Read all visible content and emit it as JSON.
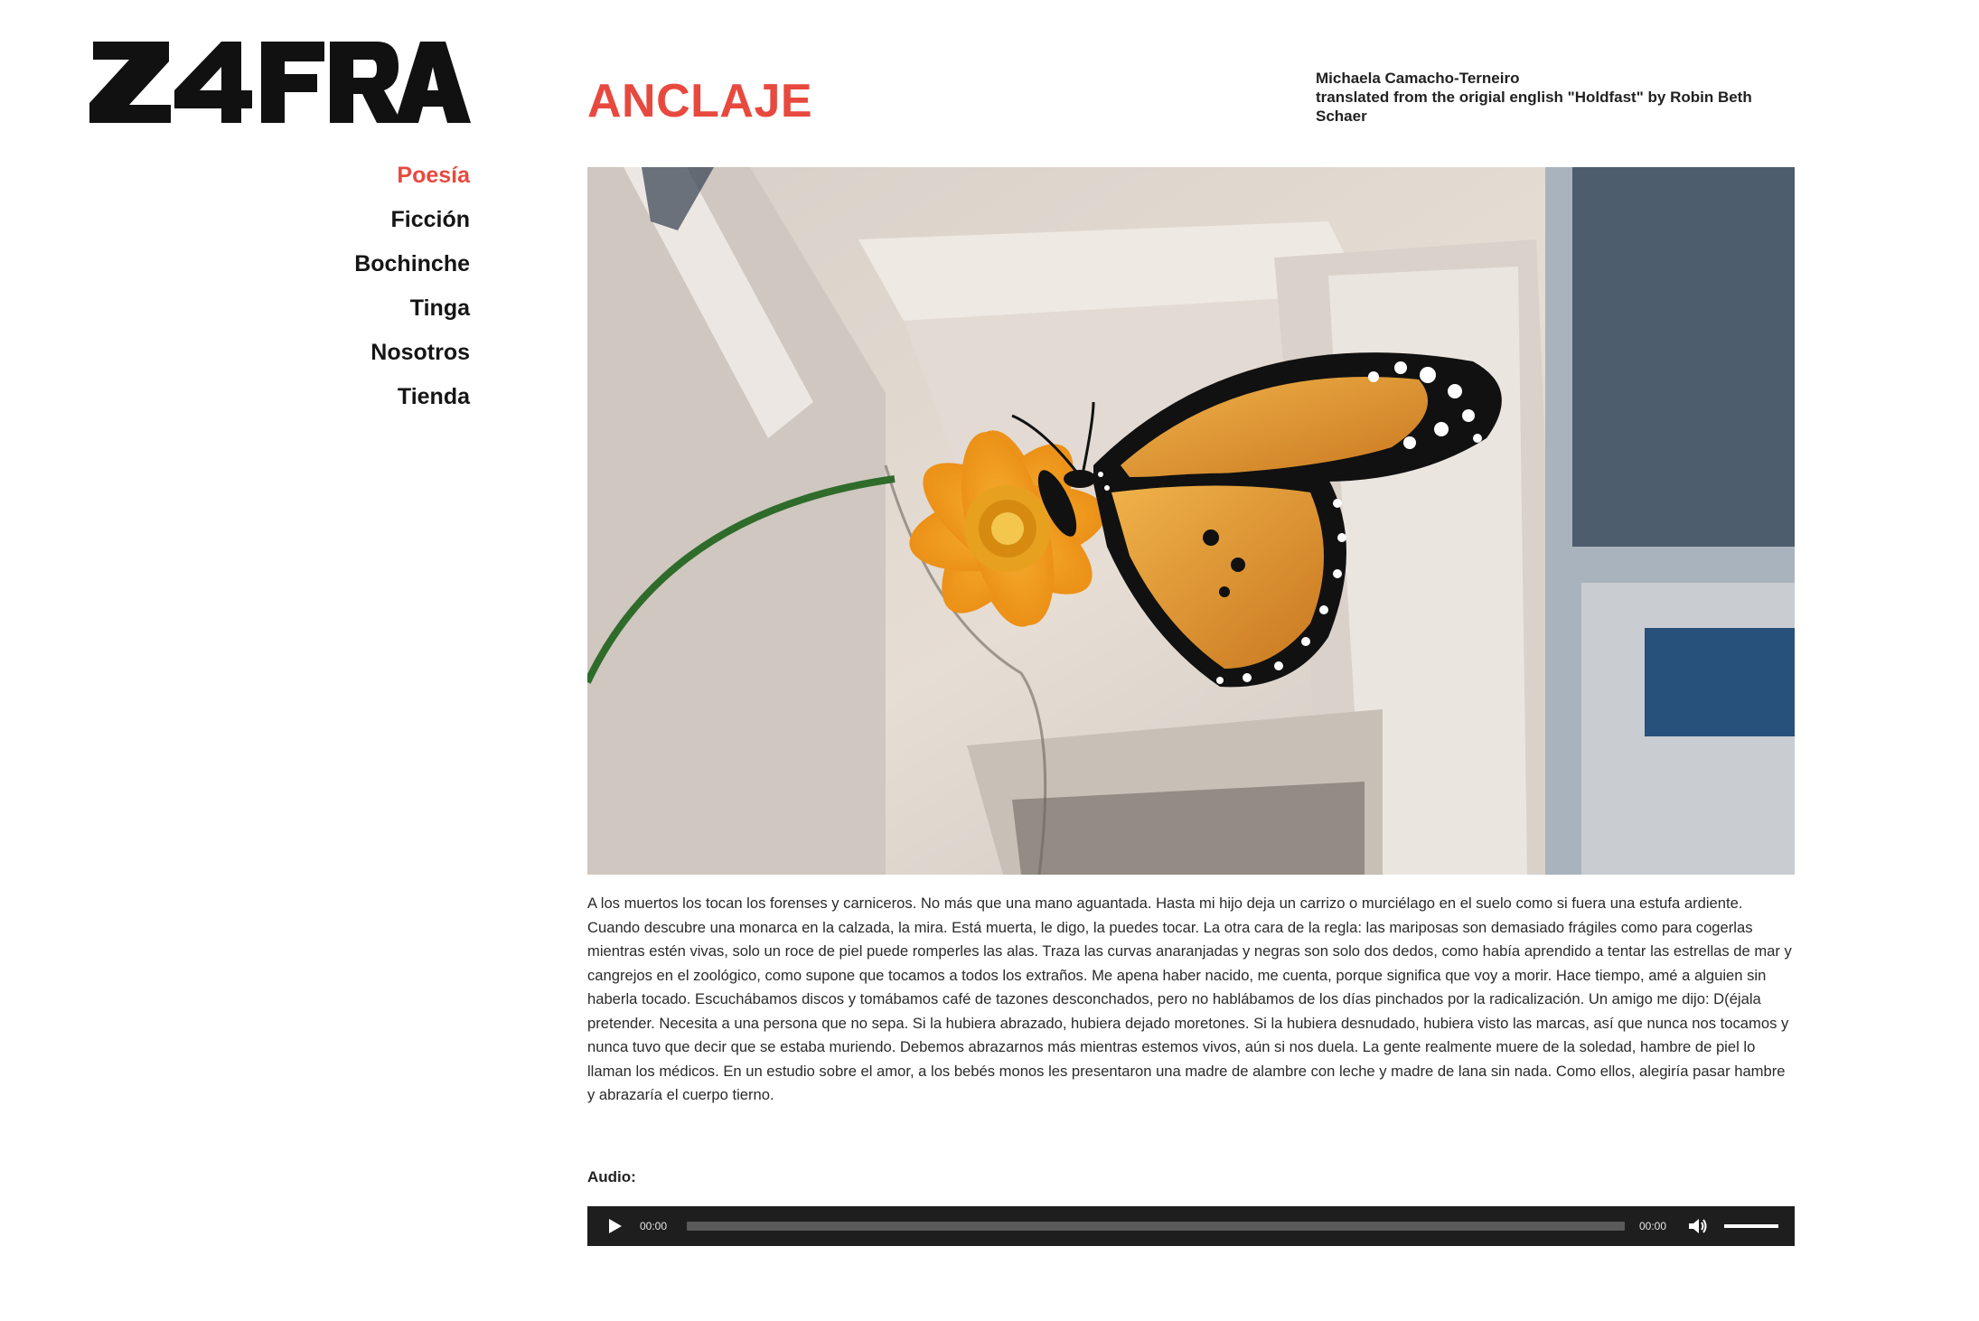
{
  "site": {
    "logo_text": "ZAFRA"
  },
  "nav": {
    "items": [
      {
        "label": "Poesía",
        "active": true
      },
      {
        "label": "Ficción",
        "active": false
      },
      {
        "label": "Bochinche",
        "active": false
      },
      {
        "label": "Tinga",
        "active": false
      },
      {
        "label": "Nosotros",
        "active": false
      },
      {
        "label": "Tienda",
        "active": false
      }
    ]
  },
  "article": {
    "title": "ANCLAJE",
    "author": "Michaela Camacho-Terneiro",
    "translation_note": "translated from the origial english \"Holdfast\" by Robin Beth Schaer",
    "hero_image": "butterfly-on-orange-flower",
    "body": "A los muertos los tocan los forenses y carniceros. No más que una mano aguantada. Hasta mi hijo deja un carrizo o murciélago en el suelo como si fuera una estufa ardiente. Cuando descubre una monarca en la calzada, la mira. Está muerta, le digo, la puedes tocar. La otra cara de la regla: las mariposas son demasiado frágiles como para cogerlas mientras estén vivas, solo un roce de piel puede romperles las alas. Traza las curvas anaranjadas y negras son solo dos dedos, como había aprendido a tentar las estrellas de mar y cangrejos en el zoológico, como supone que tocamos a todos los extraños. Me apena haber nacido, me cuenta, porque significa que voy a morir. Hace tiempo, amé a alguien sin haberla tocado. Escuchábamos discos y tomábamos café de tazones desconchados, pero no hablábamos de los días pinchados por la radicalización. Un amigo me dijo: D(éjala pretender. Necesita a una persona que no sepa. Si la hubiera abrazado, hubiera dejado moretones. Si la hubiera desnudado, hubiera visto las marcas, así que nunca nos tocamos y nunca tuvo que decir que se estaba muriendo. Debemos abrazarnos más mientras estemos vivos, aún si nos duela. La gente realmente muere de la soledad, hambre de piel lo llaman los médicos. En un estudio sobre el amor, a los bebés monos les presentaron una madre de alambre con leche y madre de lana sin nada. Como ellos, alegiría pasar hambre y abrazaría el cuerpo tierno."
  },
  "audio": {
    "label": "Audio:",
    "current_time": "00:00",
    "duration": "00:00",
    "progress": 0,
    "volume": 1.0,
    "icons": {
      "play": "play-icon",
      "mute": "volume-icon"
    }
  },
  "colors": {
    "accent": "#e8493f",
    "text": "#1b1b1b",
    "player_bg": "#1e1e1e"
  }
}
